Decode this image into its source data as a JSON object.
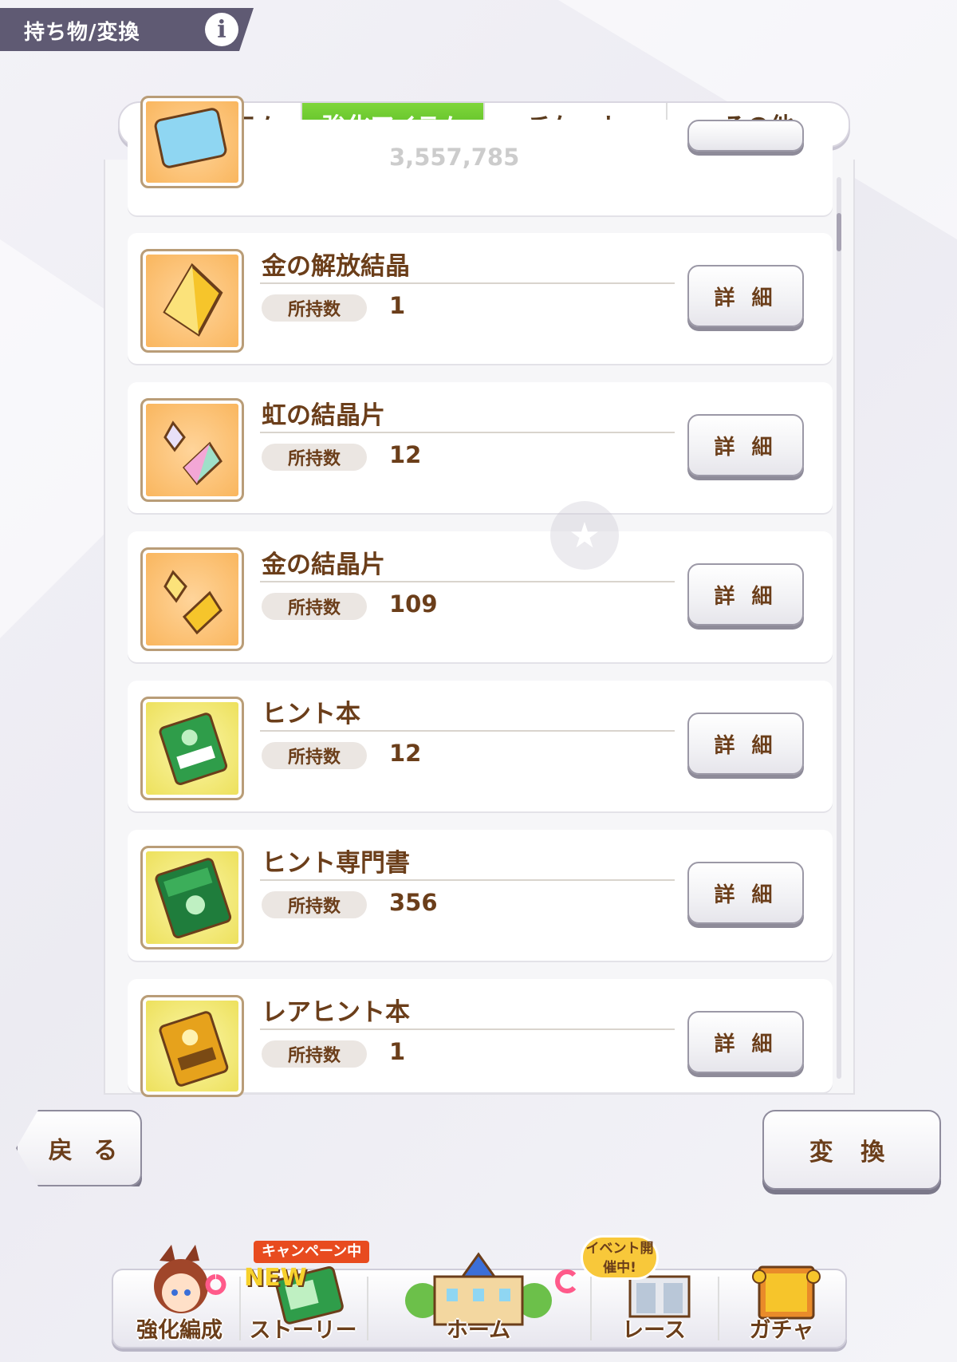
{
  "header": {
    "title": "持ち物/変換",
    "info_label": "i"
  },
  "tabs": [
    {
      "label": "消費アイテム",
      "active": false
    },
    {
      "label": "強化アイテム",
      "active": true
    },
    {
      "label": "チケット",
      "active": false
    },
    {
      "label": "その他",
      "active": false
    }
  ],
  "list": {
    "qty_label": "所持数",
    "detail_label": "詳 細",
    "items": [
      {
        "name": "金の解放結晶",
        "qty": "1",
        "icon": "gold-crystal-icon"
      },
      {
        "name": "虹の結晶片",
        "qty": "12",
        "icon": "rainbow-shard-icon"
      },
      {
        "name": "金の結晶片",
        "qty": "109",
        "icon": "gold-shard-icon"
      },
      {
        "name": "ヒント本",
        "qty": "12",
        "icon": "hint-book-icon"
      },
      {
        "name": "ヒント専門書",
        "qty": "356",
        "icon": "hint-manual-icon"
      },
      {
        "name": "レアヒント本",
        "qty": "1",
        "icon": "rare-hint-book-icon"
      }
    ],
    "partial_top_item_qty": "3,557,785"
  },
  "buttons": {
    "back": "戻 る",
    "convert": "変 換"
  },
  "nav": {
    "items": [
      {
        "label": "強化編成"
      },
      {
        "label": "ストーリー"
      },
      {
        "label": "ホーム"
      },
      {
        "label": "レース"
      },
      {
        "label": "ガチャ"
      }
    ],
    "story_campaign_badge": "キャンペーン中",
    "story_new_badge": "NEW",
    "race_event_badge": "イベント開催中!"
  },
  "colors": {
    "accent_green": "#5cc02a",
    "text_brown": "#6b3e1a",
    "header_bg": "#5f5a73"
  }
}
